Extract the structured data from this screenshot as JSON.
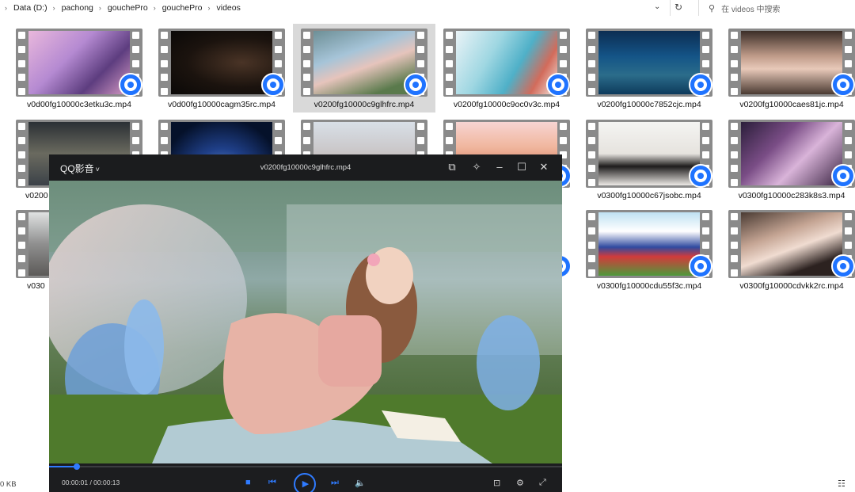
{
  "breadcrumb": [
    "Data (D:)",
    "pachong",
    "gouchePro",
    "gouchePro",
    "videos"
  ],
  "search": {
    "placeholder": "在 videos 中搜索"
  },
  "files": [
    {
      "name": "v0d00fg10000c3etku3c.mp4"
    },
    {
      "name": "v0d00fg10000cagm35rc.mp4"
    },
    {
      "name": "v0200fg10000c9glhfrc.mp4"
    },
    {
      "name": "v0200fg10000c9oc0v3c.mp4"
    },
    {
      "name": "v0200fg10000c7852cjc.mp4"
    },
    {
      "name": "v0200fg10000caes81jc.mp4"
    },
    {
      "name": "v0200"
    },
    {
      "name": "v0300fg10000c67jsobc.mp4"
    },
    {
      "name": "v0300fg10000c283k8s3.mp4"
    },
    {
      "name": "v030"
    },
    {
      "name": "v0300fg10000cdu55f3c.mp4"
    },
    {
      "name": "v0300fg10000cdvkk2rc.mp4"
    }
  ],
  "player": {
    "brand": "QQ影音",
    "brand_chevron": "˅",
    "title": "v0200fg10000c9glhfrc.mp4",
    "time": "00:00:01 / 00:00:13",
    "progress": 0.054
  },
  "status": {
    "size": "0 KB"
  }
}
